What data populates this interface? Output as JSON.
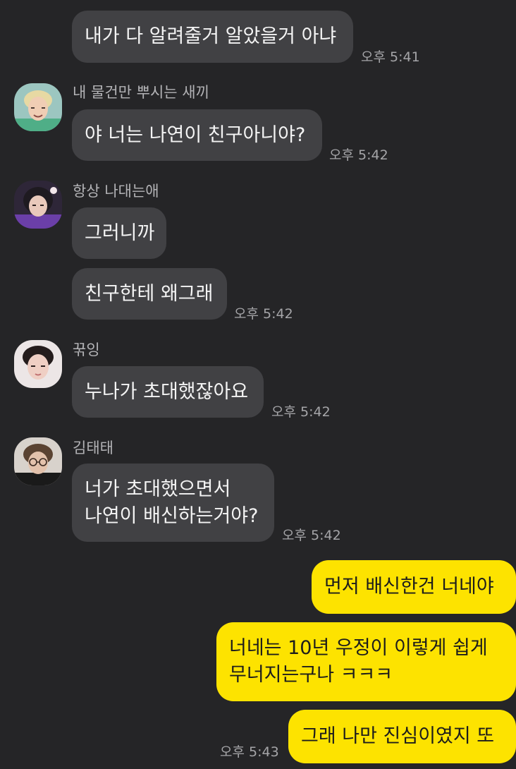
{
  "messages": {
    "m1": {
      "text": "내가 다 알려줄거 알았을거 아냐",
      "time": "오후 5:41"
    },
    "m2": {
      "sender": "내 물건만 뿌시는 새끼",
      "text": "야 너는 나연이 친구아니야?",
      "time": "오후 5:42",
      "avatar_icon": "profile-photo"
    },
    "m3": {
      "sender": "항상 나대는애",
      "text": "그러니까",
      "avatar_icon": "profile-photo"
    },
    "m4": {
      "text": "친구한테 왜그래",
      "time": "오후 5:42"
    },
    "m5": {
      "sender": "꾺잉",
      "text": "누나가 초대했잖아요",
      "time": "오후 5:42",
      "avatar_icon": "profile-photo"
    },
    "m6": {
      "sender": "김태태",
      "line1": "너가 초대했으면서",
      "line2": "나연이 배신하는거야?",
      "time": "오후 5:42",
      "avatar_icon": "profile-photo"
    },
    "m7": {
      "text": "먼저 배신한건 너네야"
    },
    "m8": {
      "line1": "너네는 10년 우정이 이렇게 쉽게",
      "line2": "무너지는구나 ㅋㅋㅋ"
    },
    "m9": {
      "text": "그래 나만 진심이였지 또",
      "time": "오후 5:43"
    }
  },
  "colors": {
    "background": "#252527",
    "incoming_bubble": "#414144",
    "outgoing_bubble": "#fde300"
  }
}
